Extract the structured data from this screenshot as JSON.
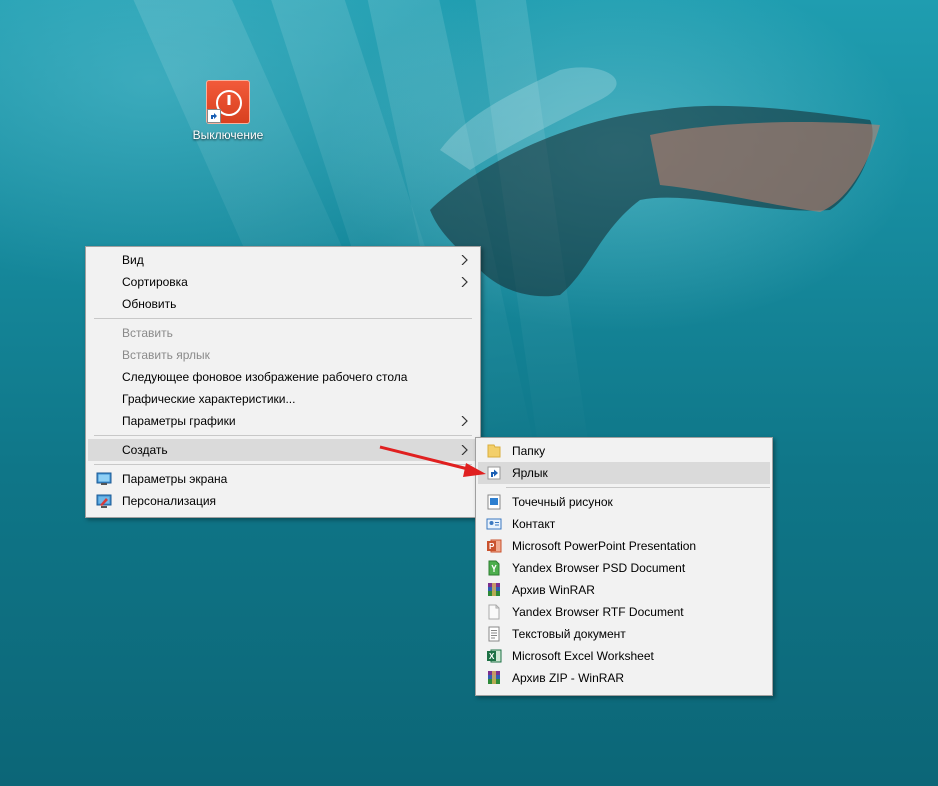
{
  "desktop": {
    "icon_label": "Выключение",
    "icon": "power-shortcut-icon"
  },
  "context_menu": {
    "view": "Вид",
    "sort": "Сортировка",
    "refresh": "Обновить",
    "paste": "Вставить",
    "paste_shortcut": "Вставить ярлык",
    "next_background": "Следующее фоновое изображение рабочего стола",
    "graphics_properties": "Графические характеристики...",
    "graphics_options": "Параметры графики",
    "new": "Создать",
    "display_settings": "Параметры экрана",
    "personalize": "Персонализация"
  },
  "submenu": {
    "items": [
      {
        "label": "Папку",
        "icon": "folder-icon"
      },
      {
        "label": "Ярлык",
        "icon": "shortcut-icon"
      },
      {
        "label": "Точечный рисунок",
        "icon": "bitmap-icon"
      },
      {
        "label": "Контакт",
        "icon": "contact-icon"
      },
      {
        "label": "Microsoft PowerPoint Presentation",
        "icon": "powerpoint-icon"
      },
      {
        "label": "Yandex Browser PSD Document",
        "icon": "yandex-psd-icon"
      },
      {
        "label": "Архив WinRAR",
        "icon": "winrar-icon"
      },
      {
        "label": "Yandex Browser RTF Document",
        "icon": "rtf-document-icon"
      },
      {
        "label": "Текстовый документ",
        "icon": "text-document-icon"
      },
      {
        "label": "Microsoft Excel Worksheet",
        "icon": "excel-icon"
      },
      {
        "label": "Архив ZIP - WinRAR",
        "icon": "zip-archive-icon"
      }
    ]
  },
  "colors": {
    "menu_bg": "#f2f2f2",
    "highlight": "#dadada",
    "annotation_arrow": "#e02020"
  }
}
